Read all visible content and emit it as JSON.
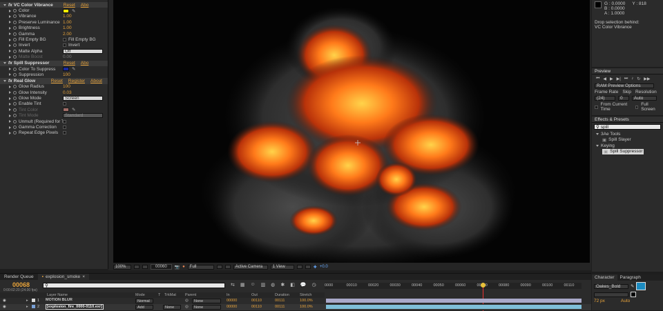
{
  "effect_controls": {
    "effects": [
      {
        "name": "VC Color Vibrance",
        "reset": "Reset",
        "about": "Abo",
        "y": 3,
        "props": [
          {
            "label": "Color",
            "type": "swatch",
            "color": "#ffee00"
          },
          {
            "label": "Vibrance",
            "value": "1.00"
          },
          {
            "label": "Preserve Luminance",
            "value": "1.00"
          },
          {
            "label": "Brightness",
            "value": "1.00"
          },
          {
            "label": "Gamma",
            "value": "2.00"
          },
          {
            "label": "Fill Empty BG",
            "type": "check",
            "check_label": "Fill Empty BG"
          },
          {
            "label": "Invert",
            "type": "check",
            "check_label": "Invert"
          },
          {
            "label": "Matte Alpha",
            "type": "dropdown",
            "value": "Off"
          },
          {
            "label": "Matte Boost",
            "value": "0.00",
            "dim": true
          }
        ]
      }
    ],
    "spill": {
      "name": "Spill Suppressor",
      "reset": "Reset",
      "about": "Abo",
      "color_label": "Color To Suppress",
      "color": "#1a2aa0",
      "suppression_label": "Suppression",
      "suppression_value": "100"
    },
    "glow": {
      "name": "Real Glow",
      "reset": "Reset",
      "register": "Register",
      "about": "About",
      "props": [
        {
          "label": "Glow Radius",
          "value": "100"
        },
        {
          "label": "Glow Intensity",
          "value": "0.03"
        },
        {
          "label": "Glow Mode",
          "type": "dropdown",
          "value": "Screen"
        },
        {
          "label": "Enable Tint",
          "type": "check"
        },
        {
          "label": "Tint Color",
          "type": "swatch",
          "color": "#f09a90",
          "dim": true
        },
        {
          "label": "Tint Mode",
          "type": "dropdown",
          "value": "Standard",
          "dim": true
        },
        {
          "label": "Unmult (Required for Te",
          "type": "check"
        },
        {
          "label": "Gamma Correction",
          "type": "check"
        },
        {
          "label": "Repeat Edge Pixels",
          "type": "check"
        }
      ]
    }
  },
  "viewer": {
    "zoom": "100%",
    "timecode": "00060",
    "resolution": "Full",
    "camera": "Active Camera",
    "views": "1 View",
    "exposure": "+0.0"
  },
  "info": {
    "g": "G : 0.0000",
    "b": "B : 0.0000",
    "a": "A : 1.0000",
    "y": "Y : 818",
    "drop_text_1": "Drop selection behind:",
    "drop_text_2": "VC Color Vibrance"
  },
  "preview": {
    "title": "Preview",
    "options": "RAM Preview Options",
    "frame_rate_label": "Frame Rate",
    "skip_label": "Skip",
    "resolution_label": "Resolution",
    "frame_rate": "(24)",
    "skip": "0",
    "resolution": "Auto",
    "from_current": "From Current Time",
    "full_screen": "Full Screen"
  },
  "effects_presets": {
    "title": "Effects & Presets",
    "search": "spill",
    "tree": [
      {
        "label": "3Ae Tools",
        "indent": 0,
        "folder": true
      },
      {
        "label": "Spill Slayer",
        "indent": 1
      },
      {
        "label": "Keying",
        "indent": 0,
        "folder": true
      },
      {
        "label": "Spill Suppressor",
        "indent": 1,
        "selected": true
      }
    ]
  },
  "timeline": {
    "tabs": [
      "Render Queue",
      "explosion_smoke"
    ],
    "timecode": "00068",
    "subtime": "0:00:02:20 (24.00 fps)",
    "columns": [
      "Layer Name",
      "Mode",
      "T",
      "TrkMat",
      "Parent",
      "In",
      "Out",
      "Duration",
      "Stretch"
    ],
    "ruler": [
      "0000",
      "00010",
      "00020",
      "00030",
      "00040",
      "00050",
      "00060",
      "00070",
      "00080",
      "00090",
      "00100",
      "00110"
    ],
    "layers": [
      {
        "num": "1",
        "name": "MOTION BLUR",
        "mode": "Normal",
        "trk": "",
        "parent": "None",
        "in": "00000",
        "out": "00110",
        "dur": "00111",
        "stretch": "100.0%"
      },
      {
        "num": "2",
        "name": "[explosion_fire_0000-0110.exr]",
        "mode": "Add",
        "trk": "None",
        "parent": "None",
        "in": "00000",
        "out": "00110",
        "dur": "00111",
        "stretch": "100.0%"
      }
    ]
  },
  "character": {
    "tabs": [
      "Character",
      "Paragraph"
    ],
    "font": "Oakes_Bold",
    "size": "72 px",
    "leading": "Auto"
  }
}
